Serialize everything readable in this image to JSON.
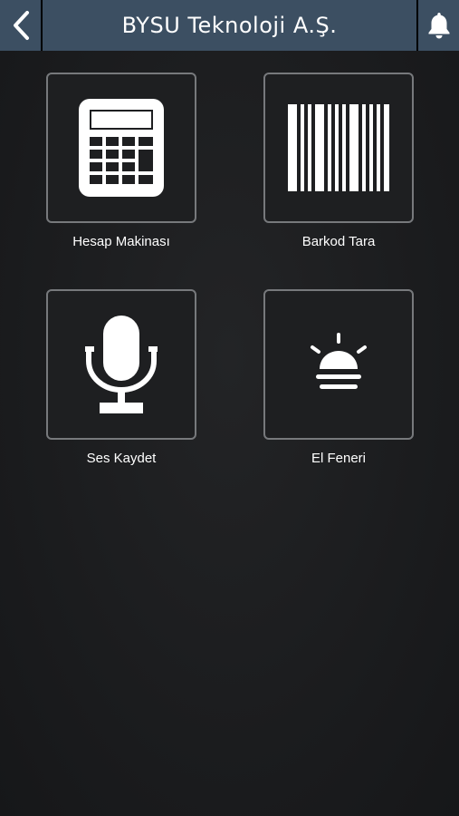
{
  "header": {
    "title": "BYSU Teknoloji A.Ş.",
    "back_icon": "chevron-left-icon",
    "notification_icon": "bell-icon"
  },
  "tiles": [
    {
      "label": "Hesap Makinası",
      "icon": "calculator-icon"
    },
    {
      "label": "Barkod Tara",
      "icon": "barcode-icon"
    },
    {
      "label": "Ses Kaydet",
      "icon": "microphone-icon"
    },
    {
      "label": "El Feneri",
      "icon": "flashlight-icon"
    }
  ],
  "colors": {
    "header_bg": "#3c4f62",
    "background": "#1c1d1f",
    "tile_border": "#77797c",
    "text": "#ffffff"
  }
}
